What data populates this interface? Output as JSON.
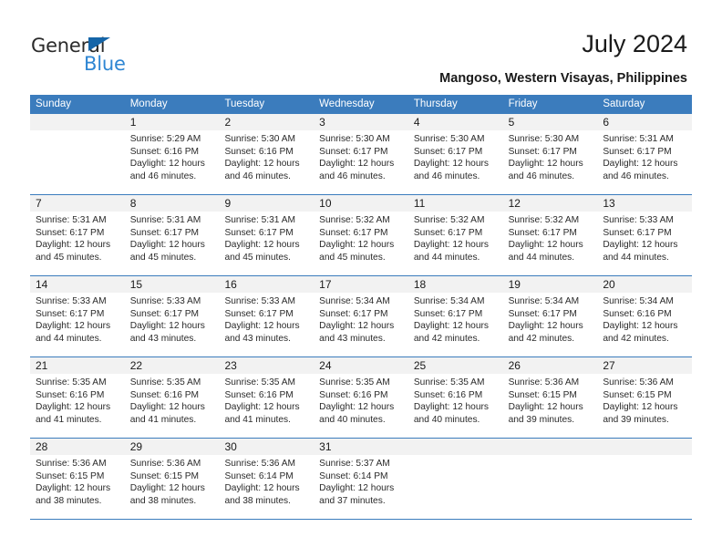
{
  "brand": {
    "name_part1": "General",
    "name_part2": "Blue",
    "triangle_color": "#1565a8",
    "blue_color": "#2e86d3"
  },
  "header": {
    "title": "July 2024",
    "subtitle": "Mangoso, Western Visayas, Philippines"
  },
  "theme": {
    "header_blue": "#3b7cbd",
    "daynum_background": "#f2f2f2",
    "cell_background": "#ffffff",
    "text_color": "#2a2a2a"
  },
  "weekdays": [
    "Sunday",
    "Monday",
    "Tuesday",
    "Wednesday",
    "Thursday",
    "Friday",
    "Saturday"
  ],
  "weeks": [
    {
      "days": [
        {
          "num": "",
          "l1": "",
          "l2": "",
          "l3": "",
          "l4": ""
        },
        {
          "num": "1",
          "l1": "Sunrise: 5:29 AM",
          "l2": "Sunset: 6:16 PM",
          "l3": "Daylight: 12 hours",
          "l4": "and 46 minutes."
        },
        {
          "num": "2",
          "l1": "Sunrise: 5:30 AM",
          "l2": "Sunset: 6:16 PM",
          "l3": "Daylight: 12 hours",
          "l4": "and 46 minutes."
        },
        {
          "num": "3",
          "l1": "Sunrise: 5:30 AM",
          "l2": "Sunset: 6:17 PM",
          "l3": "Daylight: 12 hours",
          "l4": "and 46 minutes."
        },
        {
          "num": "4",
          "l1": "Sunrise: 5:30 AM",
          "l2": "Sunset: 6:17 PM",
          "l3": "Daylight: 12 hours",
          "l4": "and 46 minutes."
        },
        {
          "num": "5",
          "l1": "Sunrise: 5:30 AM",
          "l2": "Sunset: 6:17 PM",
          "l3": "Daylight: 12 hours",
          "l4": "and 46 minutes."
        },
        {
          "num": "6",
          "l1": "Sunrise: 5:31 AM",
          "l2": "Sunset: 6:17 PM",
          "l3": "Daylight: 12 hours",
          "l4": "and 46 minutes."
        }
      ]
    },
    {
      "days": [
        {
          "num": "7",
          "l1": "Sunrise: 5:31 AM",
          "l2": "Sunset: 6:17 PM",
          "l3": "Daylight: 12 hours",
          "l4": "and 45 minutes."
        },
        {
          "num": "8",
          "l1": "Sunrise: 5:31 AM",
          "l2": "Sunset: 6:17 PM",
          "l3": "Daylight: 12 hours",
          "l4": "and 45 minutes."
        },
        {
          "num": "9",
          "l1": "Sunrise: 5:31 AM",
          "l2": "Sunset: 6:17 PM",
          "l3": "Daylight: 12 hours",
          "l4": "and 45 minutes."
        },
        {
          "num": "10",
          "l1": "Sunrise: 5:32 AM",
          "l2": "Sunset: 6:17 PM",
          "l3": "Daylight: 12 hours",
          "l4": "and 45 minutes."
        },
        {
          "num": "11",
          "l1": "Sunrise: 5:32 AM",
          "l2": "Sunset: 6:17 PM",
          "l3": "Daylight: 12 hours",
          "l4": "and 44 minutes."
        },
        {
          "num": "12",
          "l1": "Sunrise: 5:32 AM",
          "l2": "Sunset: 6:17 PM",
          "l3": "Daylight: 12 hours",
          "l4": "and 44 minutes."
        },
        {
          "num": "13",
          "l1": "Sunrise: 5:33 AM",
          "l2": "Sunset: 6:17 PM",
          "l3": "Daylight: 12 hours",
          "l4": "and 44 minutes."
        }
      ]
    },
    {
      "days": [
        {
          "num": "14",
          "l1": "Sunrise: 5:33 AM",
          "l2": "Sunset: 6:17 PM",
          "l3": "Daylight: 12 hours",
          "l4": "and 44 minutes."
        },
        {
          "num": "15",
          "l1": "Sunrise: 5:33 AM",
          "l2": "Sunset: 6:17 PM",
          "l3": "Daylight: 12 hours",
          "l4": "and 43 minutes."
        },
        {
          "num": "16",
          "l1": "Sunrise: 5:33 AM",
          "l2": "Sunset: 6:17 PM",
          "l3": "Daylight: 12 hours",
          "l4": "and 43 minutes."
        },
        {
          "num": "17",
          "l1": "Sunrise: 5:34 AM",
          "l2": "Sunset: 6:17 PM",
          "l3": "Daylight: 12 hours",
          "l4": "and 43 minutes."
        },
        {
          "num": "18",
          "l1": "Sunrise: 5:34 AM",
          "l2": "Sunset: 6:17 PM",
          "l3": "Daylight: 12 hours",
          "l4": "and 42 minutes."
        },
        {
          "num": "19",
          "l1": "Sunrise: 5:34 AM",
          "l2": "Sunset: 6:17 PM",
          "l3": "Daylight: 12 hours",
          "l4": "and 42 minutes."
        },
        {
          "num": "20",
          "l1": "Sunrise: 5:34 AM",
          "l2": "Sunset: 6:16 PM",
          "l3": "Daylight: 12 hours",
          "l4": "and 42 minutes."
        }
      ]
    },
    {
      "days": [
        {
          "num": "21",
          "l1": "Sunrise: 5:35 AM",
          "l2": "Sunset: 6:16 PM",
          "l3": "Daylight: 12 hours",
          "l4": "and 41 minutes."
        },
        {
          "num": "22",
          "l1": "Sunrise: 5:35 AM",
          "l2": "Sunset: 6:16 PM",
          "l3": "Daylight: 12 hours",
          "l4": "and 41 minutes."
        },
        {
          "num": "23",
          "l1": "Sunrise: 5:35 AM",
          "l2": "Sunset: 6:16 PM",
          "l3": "Daylight: 12 hours",
          "l4": "and 41 minutes."
        },
        {
          "num": "24",
          "l1": "Sunrise: 5:35 AM",
          "l2": "Sunset: 6:16 PM",
          "l3": "Daylight: 12 hours",
          "l4": "and 40 minutes."
        },
        {
          "num": "25",
          "l1": "Sunrise: 5:35 AM",
          "l2": "Sunset: 6:16 PM",
          "l3": "Daylight: 12 hours",
          "l4": "and 40 minutes."
        },
        {
          "num": "26",
          "l1": "Sunrise: 5:36 AM",
          "l2": "Sunset: 6:15 PM",
          "l3": "Daylight: 12 hours",
          "l4": "and 39 minutes."
        },
        {
          "num": "27",
          "l1": "Sunrise: 5:36 AM",
          "l2": "Sunset: 6:15 PM",
          "l3": "Daylight: 12 hours",
          "l4": "and 39 minutes."
        }
      ]
    },
    {
      "days": [
        {
          "num": "28",
          "l1": "Sunrise: 5:36 AM",
          "l2": "Sunset: 6:15 PM",
          "l3": "Daylight: 12 hours",
          "l4": "and 38 minutes."
        },
        {
          "num": "29",
          "l1": "Sunrise: 5:36 AM",
          "l2": "Sunset: 6:15 PM",
          "l3": "Daylight: 12 hours",
          "l4": "and 38 minutes."
        },
        {
          "num": "30",
          "l1": "Sunrise: 5:36 AM",
          "l2": "Sunset: 6:14 PM",
          "l3": "Daylight: 12 hours",
          "l4": "and 38 minutes."
        },
        {
          "num": "31",
          "l1": "Sunrise: 5:37 AM",
          "l2": "Sunset: 6:14 PM",
          "l3": "Daylight: 12 hours",
          "l4": "and 37 minutes."
        },
        {
          "num": "",
          "l1": "",
          "l2": "",
          "l3": "",
          "l4": ""
        },
        {
          "num": "",
          "l1": "",
          "l2": "",
          "l3": "",
          "l4": ""
        },
        {
          "num": "",
          "l1": "",
          "l2": "",
          "l3": "",
          "l4": ""
        }
      ]
    }
  ]
}
